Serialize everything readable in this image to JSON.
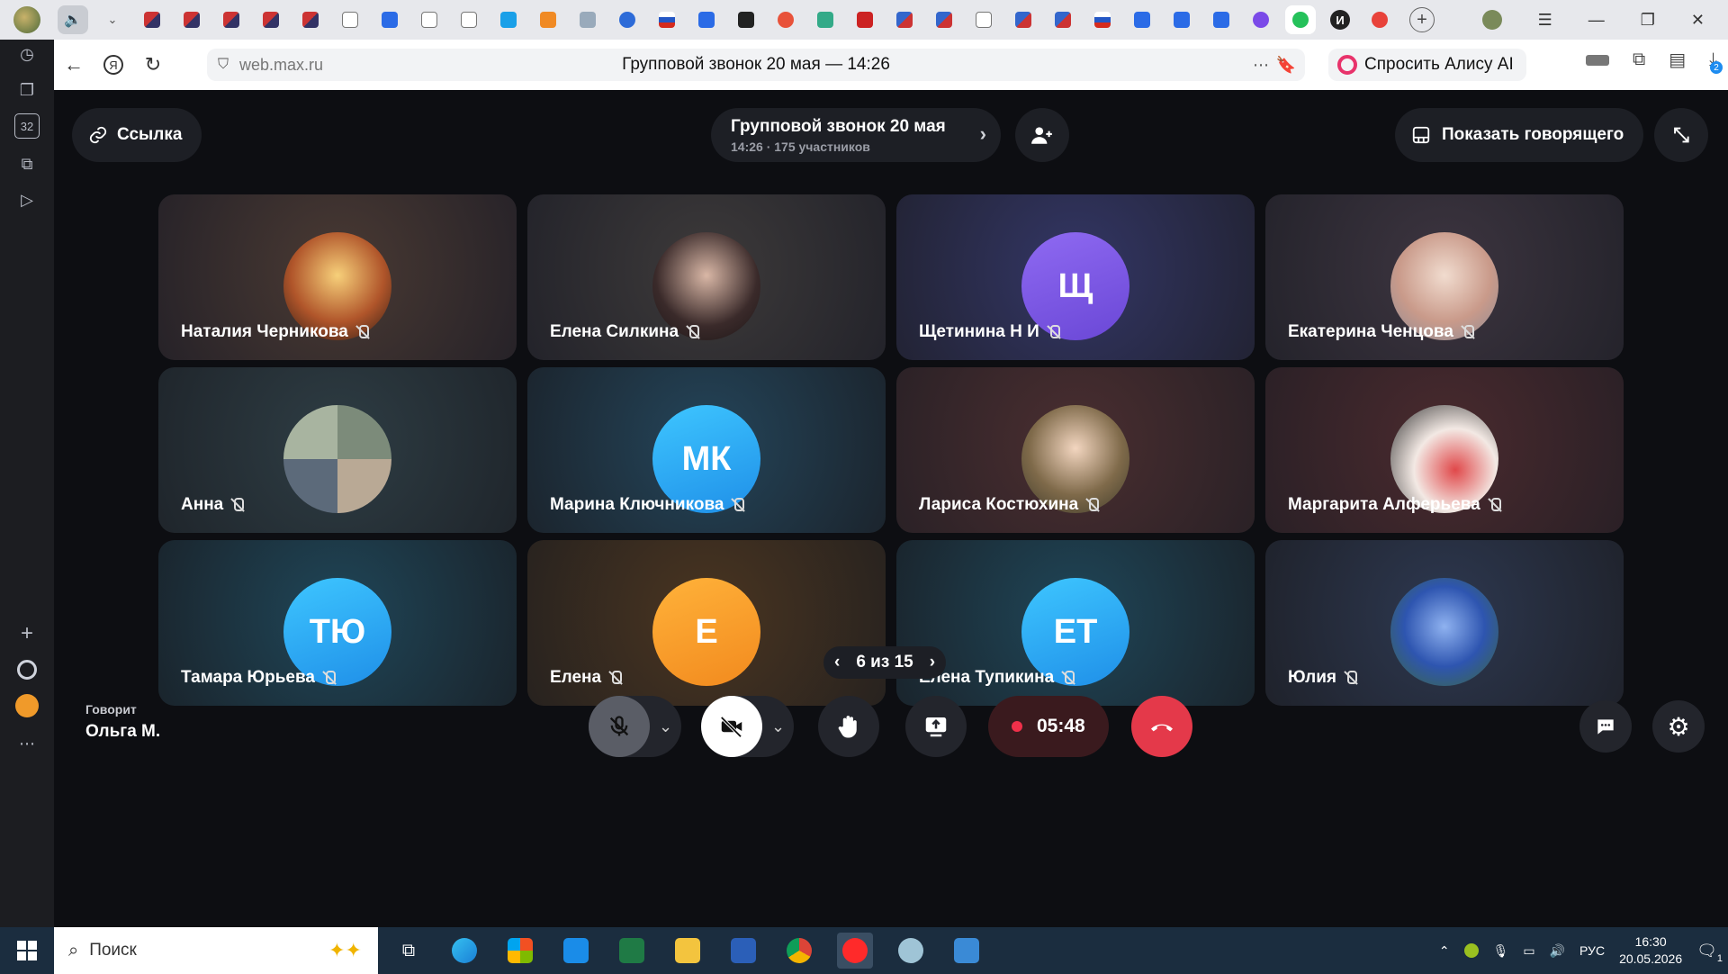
{
  "browser": {
    "url": "web.max.ru",
    "page_title": "Групповой звонок 20 мая — 14:26",
    "alice_label": "Спросить Алису AI",
    "downloads_badge": "2",
    "sidebar_badge": "32",
    "tab_badge": "И"
  },
  "call": {
    "link_label": "Ссылка",
    "title": "Групповой звонок 20 мая",
    "subtitle": "14:26 · 175 участников",
    "show_speaker_label": "Показать говорящего",
    "pager": "6 из 15",
    "speaking_label": "Говорит",
    "speaking_name": "Ольга М.",
    "timer": "05:48",
    "accent_colors": {
      "end_call": "#e4394a",
      "record_dot": "#f0304a"
    },
    "participants": [
      {
        "name": "Наталия Черникова",
        "initials": "",
        "avatar": "photo-warm-sunset",
        "muted": true
      },
      {
        "name": "Елена Силкина",
        "initials": "",
        "avatar": "photo-portrait",
        "muted": true
      },
      {
        "name": "Щетинина Н И",
        "initials": "Щ",
        "avatar": "initials-purple",
        "muted": true
      },
      {
        "name": "Екатерина Ченцова",
        "initials": "",
        "avatar": "photo-portrait-light",
        "muted": true
      },
      {
        "name": "Анна",
        "initials": "",
        "avatar": "photo-collage",
        "muted": true
      },
      {
        "name": "Марина Ключникова",
        "initials": "МК",
        "avatar": "initials-blue",
        "muted": true
      },
      {
        "name": "Лариса Костюхина",
        "initials": "",
        "avatar": "photo-portrait-green",
        "muted": true
      },
      {
        "name": "Маргарита Алферьева",
        "initials": "",
        "avatar": "photo-flowers-red",
        "muted": true
      },
      {
        "name": "Тамара Юрьева",
        "initials": "ТЮ",
        "avatar": "initials-blue",
        "muted": true
      },
      {
        "name": "Елена",
        "initials": "Е",
        "avatar": "initials-orange",
        "muted": true
      },
      {
        "name": "Елена Тупикина",
        "initials": "ЕТ",
        "avatar": "initials-blue",
        "muted": true
      },
      {
        "name": "Юлия",
        "initials": "",
        "avatar": "photo-blue-flowers",
        "muted": true
      }
    ]
  },
  "taskbar": {
    "search_placeholder": "Поиск",
    "language": "РУС",
    "time": "16:30",
    "date": "20.05.2026",
    "notification_count": "1"
  }
}
